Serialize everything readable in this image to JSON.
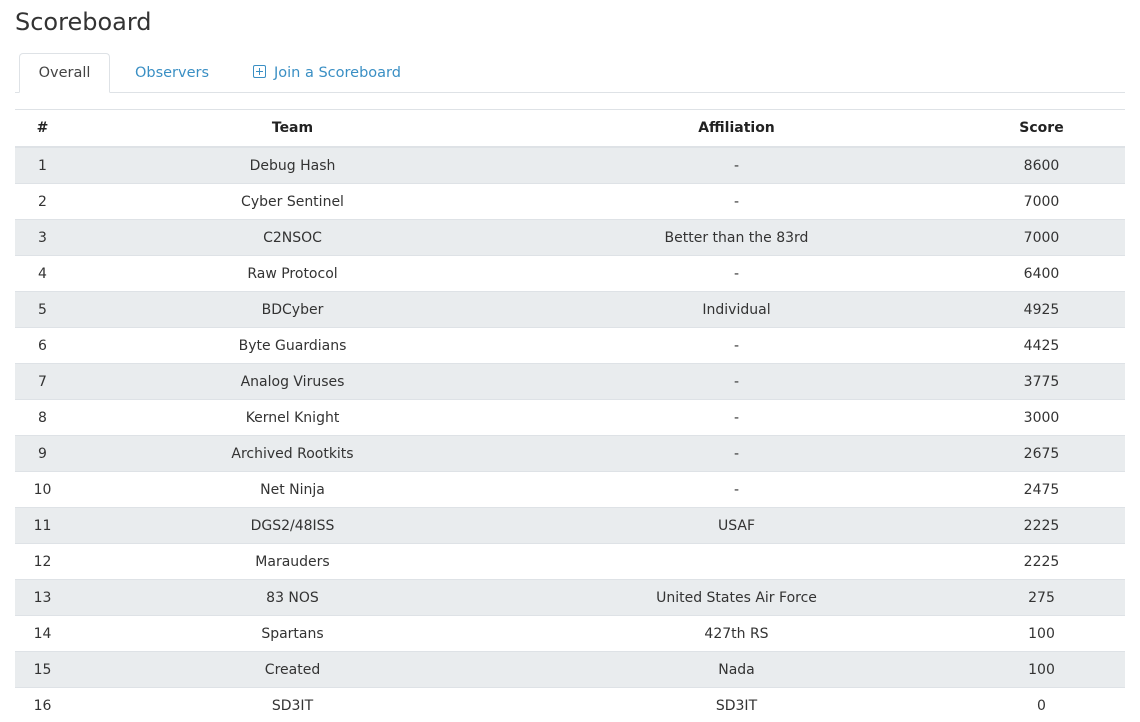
{
  "page": {
    "title": "Scoreboard"
  },
  "tabs": [
    {
      "label": "Overall",
      "active": true
    },
    {
      "label": "Observers",
      "active": false
    },
    {
      "label": "Join a Scoreboard",
      "active": false,
      "icon": "plus-square-icon"
    }
  ],
  "table": {
    "headers": {
      "rank": "#",
      "team": "Team",
      "affiliation": "Affiliation",
      "score": "Score"
    },
    "rows": [
      {
        "rank": "1",
        "team": "Debug Hash",
        "affiliation": "-",
        "score": "8600"
      },
      {
        "rank": "2",
        "team": "Cyber Sentinel",
        "affiliation": "-",
        "score": "7000"
      },
      {
        "rank": "3",
        "team": "C2NSOC",
        "affiliation": "Better than the 83rd",
        "score": "7000"
      },
      {
        "rank": "4",
        "team": "Raw Protocol",
        "affiliation": "-",
        "score": "6400"
      },
      {
        "rank": "5",
        "team": "BDCyber",
        "affiliation": "Individual",
        "score": "4925"
      },
      {
        "rank": "6",
        "team": "Byte Guardians",
        "affiliation": "-",
        "score": "4425"
      },
      {
        "rank": "7",
        "team": "Analog Viruses",
        "affiliation": "-",
        "score": "3775"
      },
      {
        "rank": "8",
        "team": "Kernel Knight",
        "affiliation": "-",
        "score": "3000"
      },
      {
        "rank": "9",
        "team": "Archived Rootkits",
        "affiliation": "-",
        "score": "2675"
      },
      {
        "rank": "10",
        "team": "Net Ninja",
        "affiliation": "-",
        "score": "2475"
      },
      {
        "rank": "11",
        "team": "DGS2/48ISS",
        "affiliation": "USAF",
        "score": "2225"
      },
      {
        "rank": "12",
        "team": "Marauders",
        "affiliation": "",
        "score": "2225"
      },
      {
        "rank": "13",
        "team": "83 NOS",
        "affiliation": "United States Air Force",
        "score": "275"
      },
      {
        "rank": "14",
        "team": "Spartans",
        "affiliation": "427th RS",
        "score": "100"
      },
      {
        "rank": "15",
        "team": "Created",
        "affiliation": "Nada",
        "score": "100"
      },
      {
        "rank": "16",
        "team": "SD3IT",
        "affiliation": "SD3IT",
        "score": "0"
      }
    ]
  },
  "colors": {
    "link": "#3a8fc4",
    "stripe": "#e9ecee",
    "border": "#dee2e6"
  }
}
